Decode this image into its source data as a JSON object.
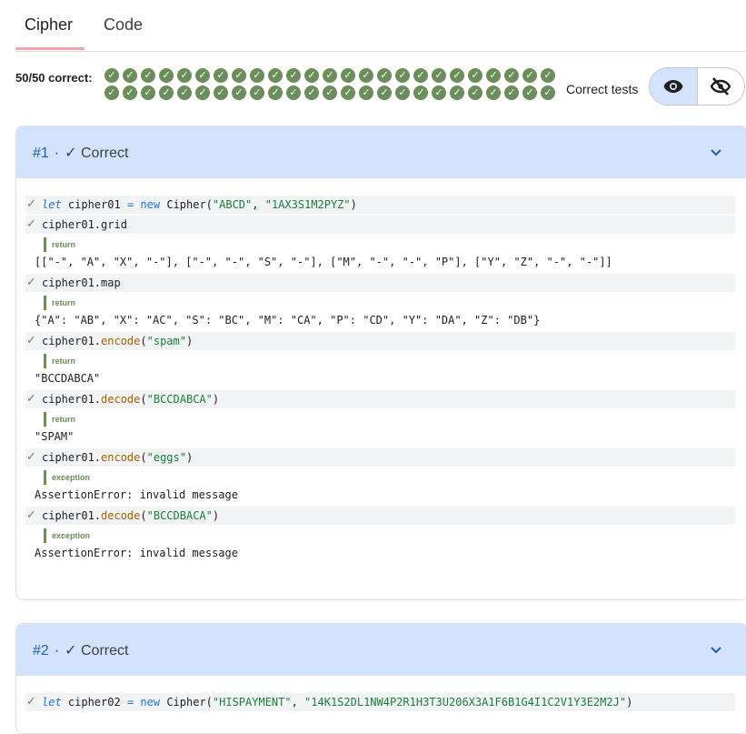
{
  "tabs": [
    {
      "label": "Cipher",
      "active": true
    },
    {
      "label": "Code",
      "active": false
    }
  ],
  "summary": {
    "label": "50/50 correct:",
    "total": 50,
    "correct": 50,
    "correct_tests_label": "Correct tests"
  },
  "colors": {
    "accent": "#1a73e8",
    "pass": "#6b8e5a",
    "header": "#d3e3fd",
    "tab_underline": "#f4a4b0"
  },
  "cards": [
    {
      "number": "#1",
      "status": "Correct",
      "statements": [
        {
          "parts": [
            {
              "t": "let",
              "c": "kw"
            },
            {
              "t": " cipher01 "
            },
            {
              "t": "=",
              "c": "op"
            },
            {
              "t": " "
            },
            {
              "t": "new",
              "c": "op"
            },
            {
              "t": " Cipher("
            },
            {
              "t": "\"ABCD\"",
              "c": "str"
            },
            {
              "t": ", "
            },
            {
              "t": "\"1AX3S1M2PYZ\"",
              "c": "str"
            },
            {
              "t": ")"
            }
          ]
        },
        {
          "parts": [
            {
              "t": "cipher01.grid"
            }
          ],
          "result": {
            "label": "return",
            "value": "[[\"-\", \"A\", \"X\", \"-\"], [\"-\", \"-\", \"S\", \"-\"], [\"M\", \"-\", \"-\", \"P\"], [\"Y\", \"Z\", \"-\", \"-\"]]"
          }
        },
        {
          "parts": [
            {
              "t": "cipher01.map"
            }
          ],
          "result": {
            "label": "return",
            "value": "{\"A\": \"AB\", \"X\": \"AC\", \"S\": \"BC\", \"M\": \"CA\", \"P\": \"CD\", \"Y\": \"DA\", \"Z\": \"DB\"}"
          }
        },
        {
          "parts": [
            {
              "t": "cipher01."
            },
            {
              "t": "encode",
              "c": "meth"
            },
            {
              "t": "("
            },
            {
              "t": "\"spam\"",
              "c": "str"
            },
            {
              "t": ")"
            }
          ],
          "result": {
            "label": "return",
            "value": "\"BCCDABCA\""
          }
        },
        {
          "parts": [
            {
              "t": "cipher01."
            },
            {
              "t": "decode",
              "c": "meth"
            },
            {
              "t": "("
            },
            {
              "t": "\"BCCDABCA\"",
              "c": "str"
            },
            {
              "t": ")"
            }
          ],
          "result": {
            "label": "return",
            "value": "\"SPAM\""
          }
        },
        {
          "parts": [
            {
              "t": "cipher01."
            },
            {
              "t": "encode",
              "c": "meth"
            },
            {
              "t": "("
            },
            {
              "t": "\"eggs\"",
              "c": "str"
            },
            {
              "t": ")"
            }
          ],
          "result": {
            "label": "exception",
            "value": "AssertionError: invalid message"
          }
        },
        {
          "parts": [
            {
              "t": "cipher01."
            },
            {
              "t": "decode",
              "c": "meth"
            },
            {
              "t": "("
            },
            {
              "t": "\"BCCDBACA\"",
              "c": "str"
            },
            {
              "t": ")"
            }
          ],
          "result": {
            "label": "exception",
            "value": "AssertionError: invalid message"
          }
        }
      ]
    },
    {
      "number": "#2",
      "status": "Correct",
      "statements": [
        {
          "parts": [
            {
              "t": "let",
              "c": "kw"
            },
            {
              "t": " cipher02 "
            },
            {
              "t": "=",
              "c": "op"
            },
            {
              "t": " "
            },
            {
              "t": "new",
              "c": "op"
            },
            {
              "t": " Cipher("
            },
            {
              "t": "\"HISPAYMENT\"",
              "c": "str"
            },
            {
              "t": ", "
            },
            {
              "t": "\"14K1S2DL1NW4P2R1H3T3U206X3A1F6B1G4I1C2V1Y3E2M2J\"",
              "c": "str"
            },
            {
              "t": ")"
            }
          ]
        }
      ]
    }
  ]
}
